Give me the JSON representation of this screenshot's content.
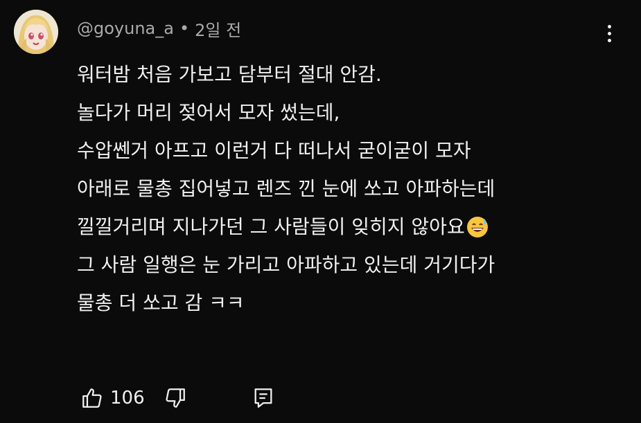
{
  "comment": {
    "author": "@goyuna_a",
    "separator": "•",
    "time": "2일 전",
    "avatar_icon": "anime-avatar-icon",
    "lines": [
      "워터밤 처음 가보고 담부터 절대 안감.",
      "놀다가 머리 젖어서 모자 썼는데,",
      "수압쎈거 아프고 이런거 다 떠나서 굳이굳이 모자",
      "아래로 물총 집어넣고 렌즈 낀 눈에 쏘고 아파하는데",
      "낄낄거리며 지나가던 그 사람들이 잊히지 않아요",
      "그 사람 일행은 눈 가리고 아파하고 있는데 거기다가",
      "물총 더 쏘고 감 ㅋㅋ"
    ],
    "emoji": "grinning-sweat-emoji",
    "like_count": "106",
    "icons": {
      "like": "thumbs-up-icon",
      "dislike": "thumbs-down-icon",
      "reply": "reply-comment-icon",
      "menu": "more-vertical-icon"
    },
    "colors": {
      "background": "#0b0b0b",
      "text": "#f1f1f1",
      "meta_text": "#aaaaaa"
    }
  }
}
